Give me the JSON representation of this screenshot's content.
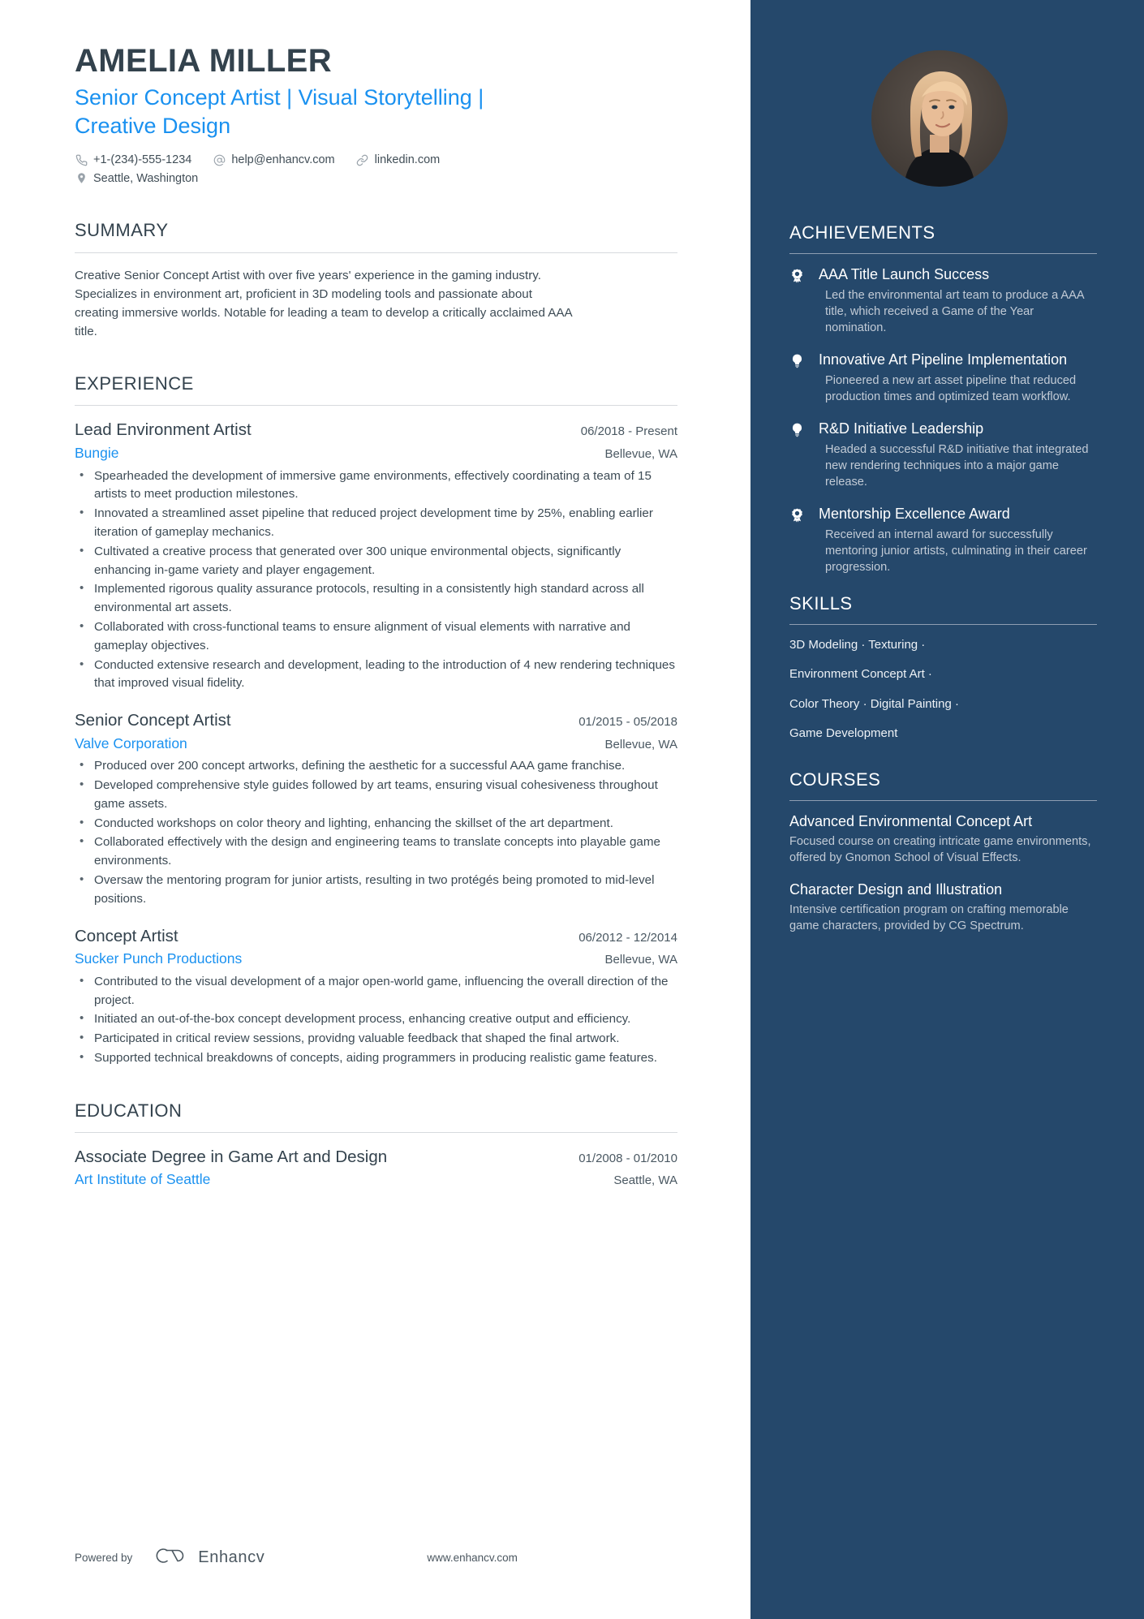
{
  "header": {
    "name": "AMELIA MILLER",
    "headline": "Senior Concept Artist | Visual Storytelling | Creative Design",
    "contacts": [
      {
        "icon": "phone-icon",
        "text": "+1-(234)-555-1234"
      },
      {
        "icon": "email-icon",
        "text": "help@enhancv.com"
      },
      {
        "icon": "link-icon",
        "text": "linkedin.com"
      }
    ],
    "location": {
      "icon": "location-pin-icon",
      "text": "Seattle, Washington"
    }
  },
  "summary": {
    "title": "SUMMARY",
    "text": "Creative Senior Concept Artist with over five years' experience in the gaming industry. Specializes in environment art, proficient in 3D modeling tools and passionate about creating immersive worlds. Notable for leading a team to develop a critically acclaimed AAA title."
  },
  "experience": {
    "title": "EXPERIENCE",
    "jobs": [
      {
        "title": "Lead Environment Artist",
        "dates": "06/2018 - Present",
        "company": "Bungie",
        "location": "Bellevue, WA",
        "bullets": [
          "Spearheaded the development of immersive game environments, effectively coordinating a team of 15 artists to meet production milestones.",
          "Innovated a streamlined asset pipeline that reduced project development time by 25%, enabling earlier iteration of gameplay mechanics.",
          "Cultivated a creative process that generated over 300 unique environmental objects, significantly enhancing in-game variety and player engagement.",
          "Implemented rigorous quality assurance protocols, resulting in a consistently high standard across all environmental art assets.",
          "Collaborated with cross-functional teams to ensure alignment of visual elements with narrative and gameplay objectives.",
          "Conducted extensive research and development, leading to the introduction of 4 new rendering techniques that improved visual fidelity."
        ]
      },
      {
        "title": "Senior Concept Artist",
        "dates": "01/2015 - 05/2018",
        "company": "Valve Corporation",
        "location": "Bellevue, WA",
        "bullets": [
          "Produced over 200 concept artworks, defining the aesthetic for a successful AAA game franchise.",
          "Developed comprehensive style guides followed by art teams, ensuring visual cohesiveness throughout game assets.",
          "Conducted workshops on color theory and lighting, enhancing the skillset of the art department.",
          "Collaborated effectively with the design and engineering teams to translate concepts into playable game environments.",
          "Oversaw the mentoring program for junior artists, resulting in two protégés being promoted to mid-level positions."
        ]
      },
      {
        "title": "Concept Artist",
        "dates": "06/2012 - 12/2014",
        "company": "Sucker Punch Productions",
        "location": "Bellevue, WA",
        "bullets": [
          "Contributed to the visual development of a major open-world game, influencing the overall direction of the project.",
          "Initiated an out-of-the-box concept development process, enhancing creative output and efficiency.",
          "Participated in critical review sessions, providng valuable feedback that shaped the final artwork.",
          "Supported technical breakdowns of concepts, aiding programmers in producing realistic game features."
        ]
      }
    ]
  },
  "education": {
    "title": "EDUCATION",
    "entries": [
      {
        "degree": "Associate Degree in Game Art and Design",
        "dates": "01/2008 - 01/2010",
        "school": "Art Institute of Seattle",
        "location": "Seattle, WA"
      }
    ]
  },
  "footer": {
    "powered_by": "Powered by",
    "brand": "Enhancv",
    "url": "www.enhancv.com"
  },
  "sidebar": {
    "achievements": {
      "title": "ACHIEVEMENTS",
      "items": [
        {
          "icon": "award-ribbon-icon",
          "title": "AAA Title Launch Success",
          "desc": "Led the environmental art team to produce a AAA title, which received a Game of the Year nomination."
        },
        {
          "icon": "lightbulb-icon",
          "title": "Innovative Art Pipeline Implementation",
          "desc": "Pioneered a new art asset pipeline that reduced production times and optimized team workflow."
        },
        {
          "icon": "lightbulb-icon",
          "title": "R&D Initiative Leadership",
          "desc": "Headed a successful R&D initiative that integrated new rendering techniques into a major game release."
        },
        {
          "icon": "award-ribbon-icon",
          "title": "Mentorship Excellence Award",
          "desc": "Received an internal award for successfully mentoring junior artists, culminating in their career progression."
        }
      ]
    },
    "skills": {
      "title": "SKILLS",
      "lines": [
        "3D Modeling · Texturing ·",
        "Environment Concept Art ·",
        "Color Theory · Digital Painting ·",
        "Game Development"
      ]
    },
    "courses": {
      "title": "COURSES",
      "items": [
        {
          "title": "Advanced Environmental Concept Art",
          "desc": "Focused course on creating intricate game environments, offered by Gnomon School of Visual Effects."
        },
        {
          "title": "Character Design and Illustration",
          "desc": "Intensive certification program on crafting memorable game characters, provided by CG Spectrum."
        }
      ]
    }
  },
  "colors": {
    "sidebar_bg": "#25486b",
    "accent_blue": "#1a91f0",
    "heading": "#33424d"
  }
}
